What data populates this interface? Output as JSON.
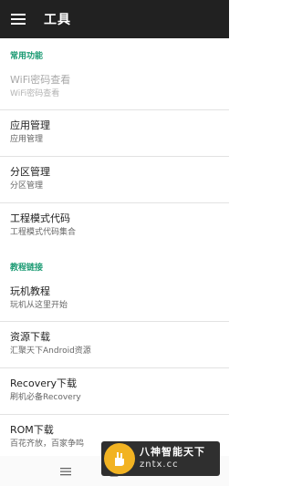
{
  "app": {
    "title": "工具",
    "menu_icon": "hamburger-menu-icon"
  },
  "sections": [
    {
      "header": "常用功能",
      "items": [
        {
          "title": "WiFi密码查看",
          "subtitle": "WiFi密码查看",
          "disabled": true
        },
        {
          "title": "应用管理",
          "subtitle": "应用管理"
        },
        {
          "title": "分区管理",
          "subtitle": "分区管理"
        },
        {
          "title": "工程模式代码",
          "subtitle": "工程模式代码集合"
        }
      ]
    },
    {
      "header": "教程链接",
      "items": [
        {
          "title": "玩机教程",
          "subtitle": "玩机从这里开始"
        },
        {
          "title": "资源下载",
          "subtitle": "汇聚天下Android资源"
        },
        {
          "title": "Recovery下载",
          "subtitle": "刷机必备Recovery"
        },
        {
          "title": "ROM下载",
          "subtitle": "百花齐放，百家争鸣"
        }
      ]
    }
  ],
  "navbar": {
    "icons": [
      "menu-lines-icon",
      "home-icon",
      "back-icon"
    ]
  },
  "watermark": {
    "line1": "八神智能天下",
    "line2": "zntx.cc"
  },
  "colors": {
    "appbar": "#212121",
    "accent": "#1a9a72"
  }
}
